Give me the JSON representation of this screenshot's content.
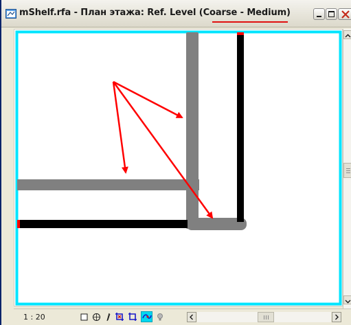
{
  "window": {
    "title": "mShelf.rfa - План этажа: Ref. Level (Coarse - Medium)",
    "app_icon": "revit-document-icon",
    "controls": {
      "minimize_icon": "minimize-icon",
      "maximize_icon": "maximize-icon",
      "close_icon": "close-icon"
    }
  },
  "colors": {
    "crop_region": "#00e5ff",
    "wall_cut": "#000000",
    "wall_projection": "#808080",
    "annotation_arrow": "#ff0000",
    "title_highlight": "#e01010",
    "active_tool": "#00d8f0"
  },
  "view_control_bar": {
    "scale": "1 : 20",
    "icons": [
      "detail-level-icon",
      "visual-style-icon",
      "sun-path-icon",
      "crop-view-icon",
      "show-crop-region-icon",
      "temporary-hide-isolate-icon",
      "reveal-hidden-elements-icon"
    ],
    "active_icon": "temporary-hide-isolate-icon"
  },
  "scrollbars": {
    "vertical": {
      "up_icon": "scroll-up-icon",
      "down_icon": "scroll-down-icon"
    },
    "horizontal": {
      "left_icon": "scroll-left-icon",
      "right_icon": "scroll-right-icon"
    }
  }
}
